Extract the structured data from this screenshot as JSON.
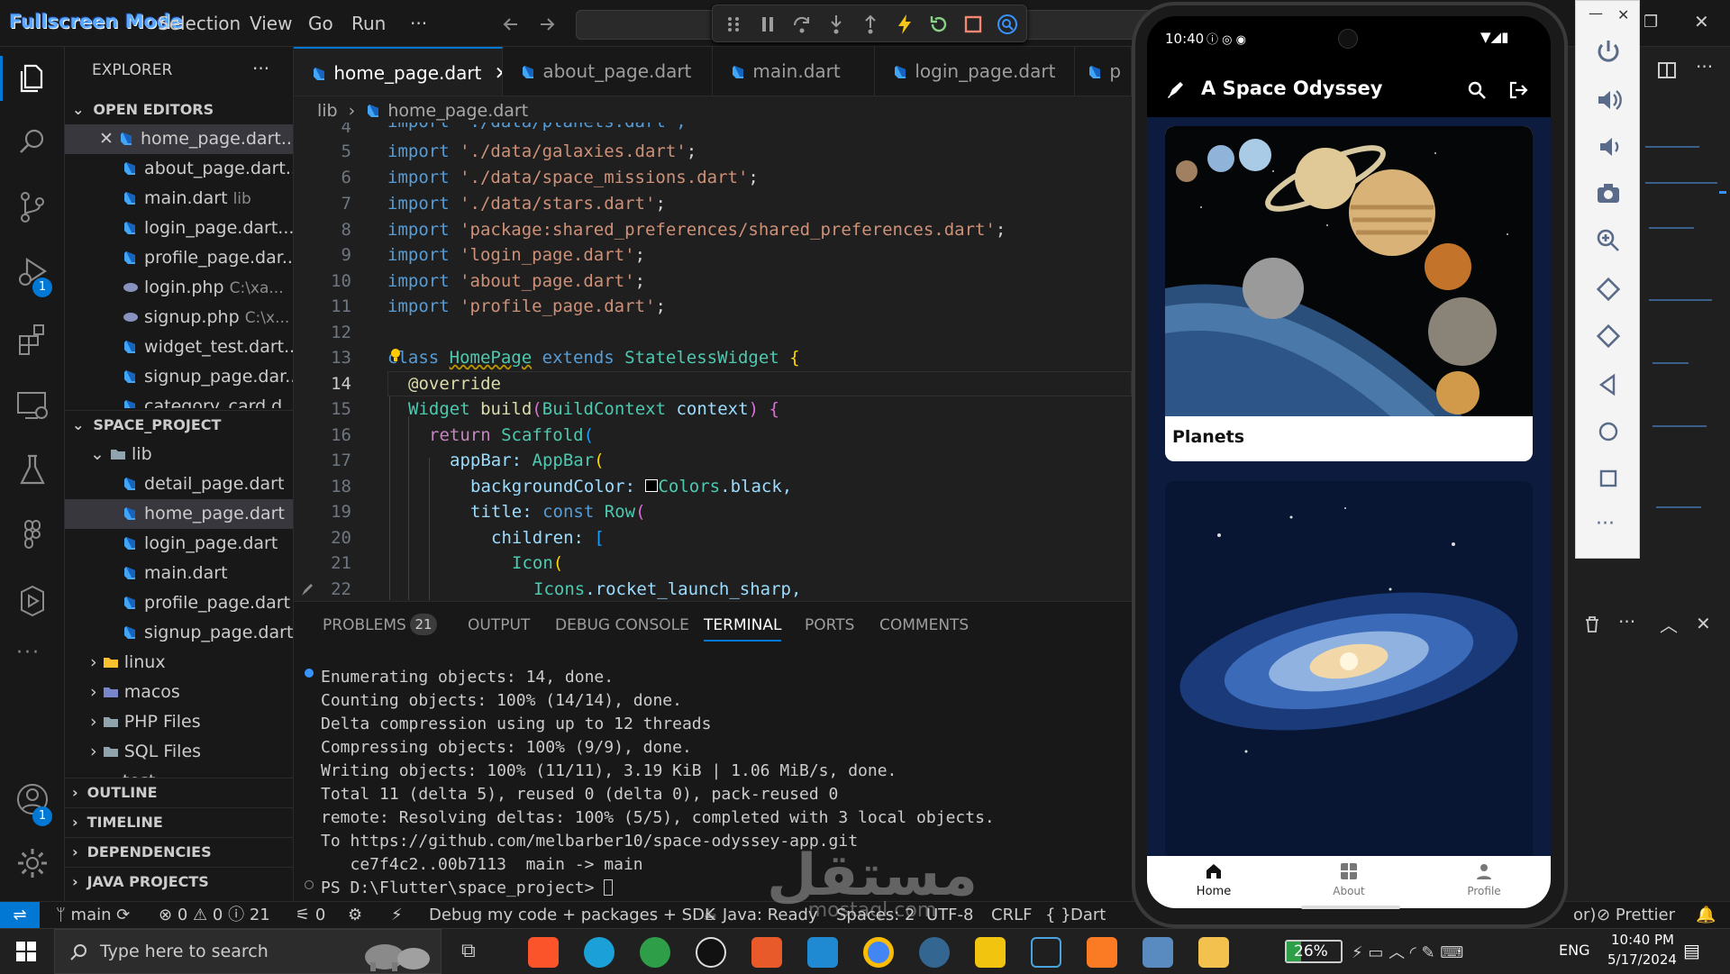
{
  "titlebar": {
    "overlay_text": "Fullscreen Mode",
    "menu": [
      "Selection",
      "View",
      "Go",
      "Run",
      "···"
    ]
  },
  "activity": {
    "debug_badge": "1",
    "account_badge": "1"
  },
  "sidebar": {
    "title": "EXPLORER",
    "more": "···",
    "open_editors_label": "OPEN EDITORS",
    "open_editors": [
      {
        "name": "home_page.dart...",
        "hint": ""
      },
      {
        "name": "about_page.dart...",
        "hint": ""
      },
      {
        "name": "main.dart",
        "hint": "lib"
      },
      {
        "name": "login_page.dart...",
        "hint": ""
      },
      {
        "name": "profile_page.dar...",
        "hint": ""
      },
      {
        "name": "login.php",
        "hint": "C:\\xa..."
      },
      {
        "name": "signup.php",
        "hint": "C:\\x..."
      },
      {
        "name": "widget_test.dart...",
        "hint": ""
      },
      {
        "name": "signup_page.dar...",
        "hint": ""
      },
      {
        "name": "category_card.d...",
        "hint": ""
      }
    ],
    "project_label": "SPACE_PROJECT",
    "lib_folder": "lib",
    "lib_files": [
      "detail_page.dart",
      "home_page.dart",
      "login_page.dart",
      "main.dart",
      "profile_page.dart",
      "signup_page.dart"
    ],
    "folders": [
      "linux",
      "macos",
      "PHP Files",
      "SQL Files"
    ],
    "truncated_folder": "test",
    "bottom_sections": [
      "OUTLINE",
      "TIMELINE",
      "DEPENDENCIES",
      "JAVA PROJECTS"
    ]
  },
  "tabs": [
    "home_page.dart",
    "about_page.dart",
    "main.dart",
    "login_page.dart",
    "p"
  ],
  "breadcrumb": {
    "folder": "lib",
    "file": "home_page.dart"
  },
  "code": {
    "line_numbers": [
      "4",
      "5",
      "6",
      "7",
      "8",
      "9",
      "10",
      "11",
      "12",
      "13",
      "14",
      "15",
      "16",
      "17",
      "18",
      "19",
      "20",
      "21",
      "22"
    ],
    "line4": "import './data/planets.dart';",
    "imp_kw": "import",
    "imports": [
      "'./data/galaxies.dart'",
      "'./data/space_missions.dart'",
      "'./data/stars.dart'",
      "'package:shared_preferences/shared_preferences.dart'",
      "'login_page.dart'",
      "'about_page.dart'",
      "'profile_page.dart'"
    ],
    "semi": ";",
    "class_kw": "class",
    "class_name": "HomePage",
    "extends_kw": "extends",
    "base_class": "StatelessWidget",
    "brace_open": "{",
    "override": "@override",
    "widget": "Widget",
    "build": "build",
    "paren_open": "(",
    "build_ctx_type": "BuildContext",
    "build_ctx_var": "context",
    "build_tail": ") {",
    "return_kw": "return",
    "scaffold": "Scaffold",
    "appbar_prop": "appBar:",
    "appbar_cls": "AppBar",
    "bg_prop": "backgroundColor:",
    "colors_cls": "Colors",
    "colors_black": ".black,",
    "title_prop": "title:",
    "const_kw": "const",
    "row_cls": "Row",
    "children_prop": "children:",
    "bracket": "[",
    "icon_cls": "Icon",
    "icons_cls": "Icons",
    "icons_val": ".rocket_launch_sharp,"
  },
  "panel": {
    "tabs": [
      "PROBLEMS",
      "OUTPUT",
      "DEBUG CONSOLE",
      "TERMINAL",
      "PORTS",
      "COMMENTS"
    ],
    "problems_count": "21",
    "terminal": [
      "Enumerating objects: 14, done.",
      "Counting objects: 100% (14/14), done.",
      "Delta compression using up to 12 threads",
      "Compressing objects: 100% (9/9), done.",
      "Writing objects: 100% (11/11), 3.19 KiB | 1.06 MiB/s, done.",
      "Total 11 (delta 5), reused 0 (delta 0), pack-reused 0",
      "remote: Resolving deltas: 100% (5/5), completed with 3 local objects.",
      "To https://github.com/melbarber10/space-odyssey-app.git",
      "   ce7f4c2..00b7113  main -> main",
      "PS D:\\Flutter\\space_project> "
    ]
  },
  "status": {
    "branch": "main",
    "errors": "0",
    "warnings": "0",
    "infos": "21",
    "ports": "0",
    "debug": "Debug my code + packages + SDK",
    "java": "Java: Ready",
    "spaces": "Spaces: 2",
    "encoding": "UTF-8",
    "eol": "CRLF",
    "braces": "{ }",
    "lang": "Dart",
    "fragment": "or)",
    "prettier": "Prettier"
  },
  "phone": {
    "time": "10:40",
    "app_title": "A Space Odyssey",
    "card1_title": "Planets",
    "nav": [
      "Home",
      "About",
      "Profile"
    ]
  },
  "taskbar": {
    "search_placeholder": "Type here to search",
    "battery": "26%",
    "lang": "ENG",
    "time": "10:40 PM",
    "date": "5/17/2024"
  },
  "watermark": {
    "arabic": "مستقل",
    "latin": "mostaql.com"
  }
}
